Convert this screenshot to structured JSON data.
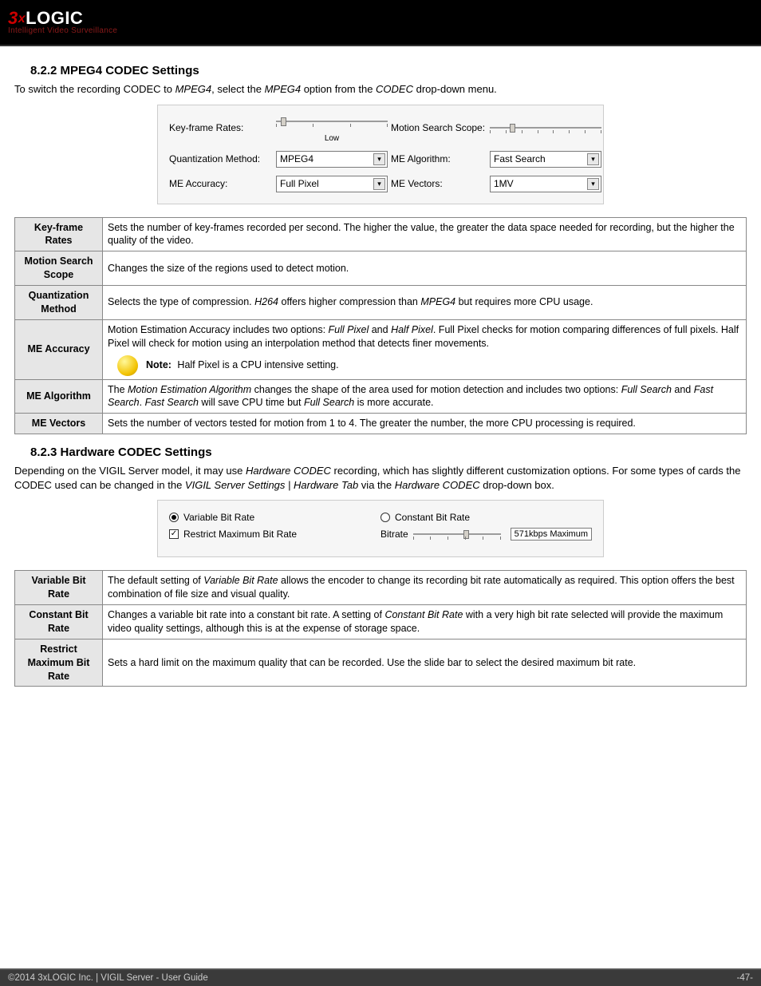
{
  "logo": {
    "brand_pre": "3",
    "brand_x": "x",
    "brand_rest": "LOGIC",
    "tagline": "Intelligent Video Surveillance"
  },
  "sec822": {
    "title": "8.2.2 MPEG4 CODEC Settings",
    "intro_pre": "To switch the recording CODEC to ",
    "intro_em1": "MPEG4",
    "intro_mid": ", select the ",
    "intro_em2": "MPEG4",
    "intro_mid2": " option from the ",
    "intro_em3": "CODEC",
    "intro_end": " drop-down menu."
  },
  "shot1": {
    "keyframe_label": "Key-frame Rates:",
    "keyframe_caption": "Low",
    "motion_scope_label": "Motion Search Scope:",
    "quant_label": "Quantization Method:",
    "quant_value": "MPEG4",
    "mealg_label": "ME Algorithm:",
    "mealg_value": "Fast Search",
    "meacc_label": "ME Accuracy:",
    "meacc_value": "Full Pixel",
    "mevec_label": "ME Vectors:",
    "mevec_value": "1MV"
  },
  "table1": [
    {
      "term": "Key-frame Rates",
      "desc": "Sets the number of key-frames recorded per second. The higher the value, the greater the data space needed for recording, but the higher the quality of the video."
    },
    {
      "term": "Motion Search Scope",
      "desc": "Changes the size of the regions used to detect motion."
    },
    {
      "term": "Quantization Method",
      "desc_pre": "Selects the type of compression. ",
      "em1": "H264",
      "desc_mid": " offers higher compression than ",
      "em2": "MPEG4",
      "desc_end": " but requires more CPU usage."
    },
    {
      "term": "ME Accuracy",
      "desc_pre": "Motion Estimation Accuracy includes two options: ",
      "em1": "Full Pixel",
      "mid1": " and ",
      "em2": "Half Pixel",
      "desc_end": ". Full Pixel checks for motion comparing differences of full pixels. Half Pixel will check for motion using an interpolation method that detects finer movements.",
      "note_label": "Note:",
      "note_text": " Half Pixel is a CPU intensive setting."
    },
    {
      "term": "ME Algorithm",
      "pre": "The ",
      "em1": "Motion Estimation Algorithm",
      "mid": " changes the shape of the area used for motion detection and includes two options: ",
      "em2": "Full Search",
      "and": " and ",
      "em3": "Fast Search",
      "post1": ". ",
      "em4": "Fast Search",
      "post2": " will save CPU time but ",
      "em5": "Full Search",
      "post3": " is more accurate."
    },
    {
      "term": "ME Vectors",
      "desc": "Sets the number of vectors tested for motion from 1 to 4. The greater the number, the more CPU processing is required."
    }
  ],
  "sec823": {
    "title": "8.2.3 Hardware CODEC Settings",
    "p_pre": "Depending on the VIGIL Server model, it may use ",
    "p_em1": "Hardware CODEC",
    "p_mid1": " recording, which has slightly different customization options. For some types of cards the CODEC used can be changed in the ",
    "p_em2": "VIGIL Server Settings | Hardware Tab",
    "p_mid2": " via the ",
    "p_em3": "Hardware CODEC",
    "p_end": " drop-down box."
  },
  "shot2": {
    "vbr": "Variable Bit Rate",
    "cbr": "Constant Bit Rate",
    "restrict": "Restrict Maximum Bit Rate",
    "bitrate_label": "Bitrate",
    "bitrate_value": "571kbps Maximum"
  },
  "table2": [
    {
      "term": "Variable Bit Rate",
      "pre": "The default setting of ",
      "em": "Variable Bit Rate",
      "post": " allows the encoder to change its recording bit rate automatically as required. This option offers the best combination of file size and visual quality."
    },
    {
      "term": "Constant Bit Rate",
      "pre": "Changes a variable bit rate into a constant bit rate. A setting of ",
      "em": "Constant Bit Rate",
      "post": " with a very high bit rate selected will provide the maximum video quality settings, although this is at the expense of storage space."
    },
    {
      "term": "Restrict Maximum Bit Rate",
      "desc": "Sets a hard limit on the maximum quality that can be recorded. Use the slide bar to select the desired maximum bit rate."
    }
  ],
  "footer": {
    "left": "©2014 3xLOGIC Inc.  |  VIGIL Server - User Guide",
    "right": "-47-"
  }
}
